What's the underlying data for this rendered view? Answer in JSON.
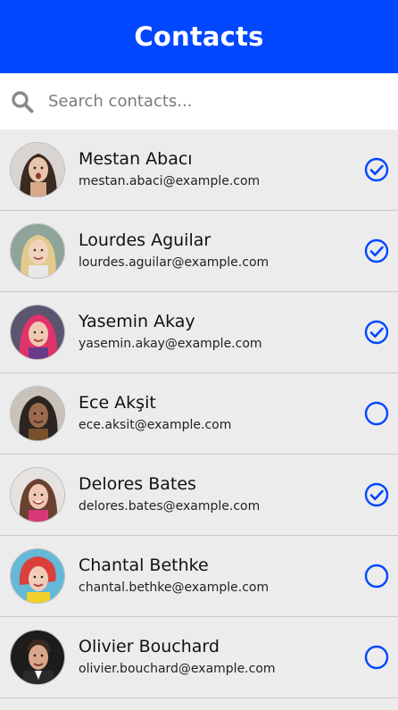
{
  "app": {
    "title": "Contacts",
    "accent_color": "#0047ff"
  },
  "search": {
    "placeholder": "Search contacts...",
    "value": ""
  },
  "contacts": [
    {
      "name": "Mestan Abacı",
      "email": "mestan.abaci@example.com",
      "selected": true
    },
    {
      "name": "Lourdes Aguilar",
      "email": "lourdes.aguilar@example.com",
      "selected": true
    },
    {
      "name": "Yasemin Akay",
      "email": "yasemin.akay@example.com",
      "selected": true
    },
    {
      "name": "Ece Akşit",
      "email": "ece.aksit@example.com",
      "selected": false
    },
    {
      "name": "Delores Bates",
      "email": "delores.bates@example.com",
      "selected": true
    },
    {
      "name": "Chantal Bethke",
      "email": "chantal.bethke@example.com",
      "selected": false
    },
    {
      "name": "Olivier Bouchard",
      "email": "olivier.bouchard@example.com",
      "selected": false
    }
  ]
}
